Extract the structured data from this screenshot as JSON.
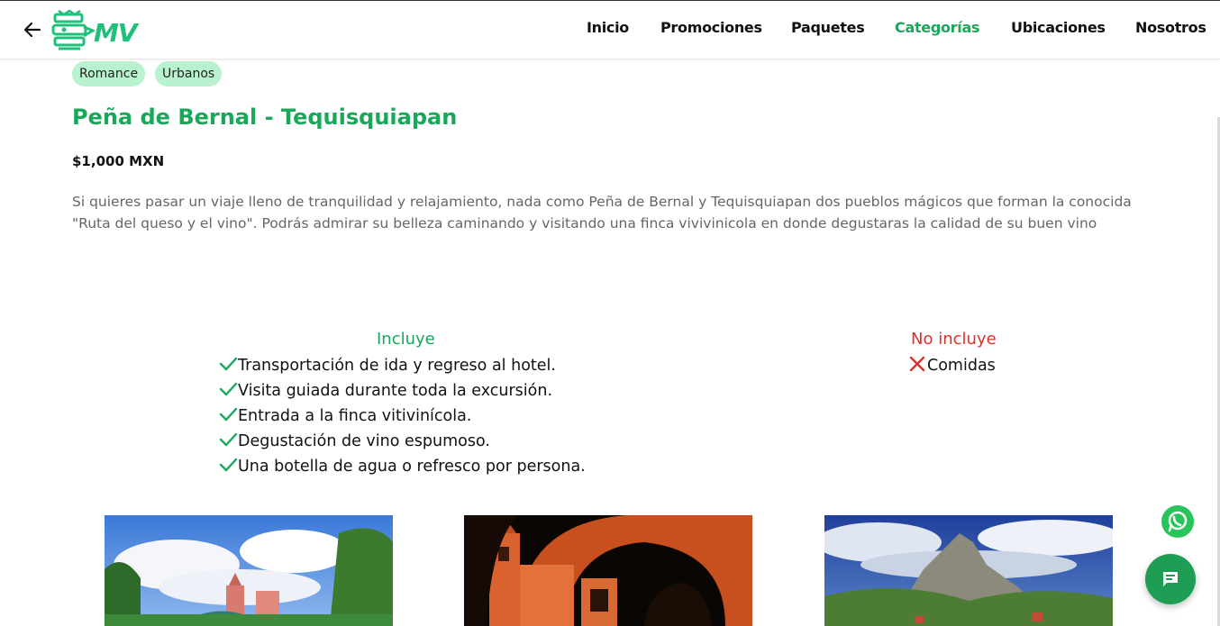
{
  "header": {
    "logo_text": "MV",
    "nav": [
      "Inicio",
      "Promociones",
      "Paquetes",
      "Categorías",
      "Ubicaciones",
      "Nosotros"
    ],
    "active_nav": "Categorías"
  },
  "tags": [
    "Romance",
    "Urbanos"
  ],
  "package": {
    "title": "Peña de Bernal - Tequisquiapan",
    "price": "$1,000 MXN",
    "description": "Si quieres pasar un viaje lleno de tranquilidad y relajamiento, nada como Peña de Bernal y Tequisquiapan dos pueblos mágicos que forman la conocida \"Ruta del queso y el vino\". Podrás admirar su belleza caminando y visitando una finca vivivinicola en donde degustaras la calidad de su buen vino"
  },
  "includes": {
    "title": "Incluye",
    "items": [
      "Transportación de ida y regreso al hotel.",
      "Visita guiada durante toda la excursión.",
      "Entrada a la finca vitivinícola.",
      "Degustación de vino espumoso.",
      "Una botella de agua o refresco por persona."
    ]
  },
  "excludes": {
    "title": "No incluye",
    "items": [
      "Comidas"
    ]
  },
  "colors": {
    "accent_green": "#19a85a",
    "tag_bg": "#b8f2cf",
    "exclude_red": "#d9322d",
    "chat_button": "#1e9e55"
  },
  "icons": {
    "back": "arrow-left-icon",
    "include_mark": "check-icon",
    "exclude_mark": "x-icon",
    "whatsapp": "whatsapp-icon",
    "chat": "chat-bubble-icon"
  }
}
